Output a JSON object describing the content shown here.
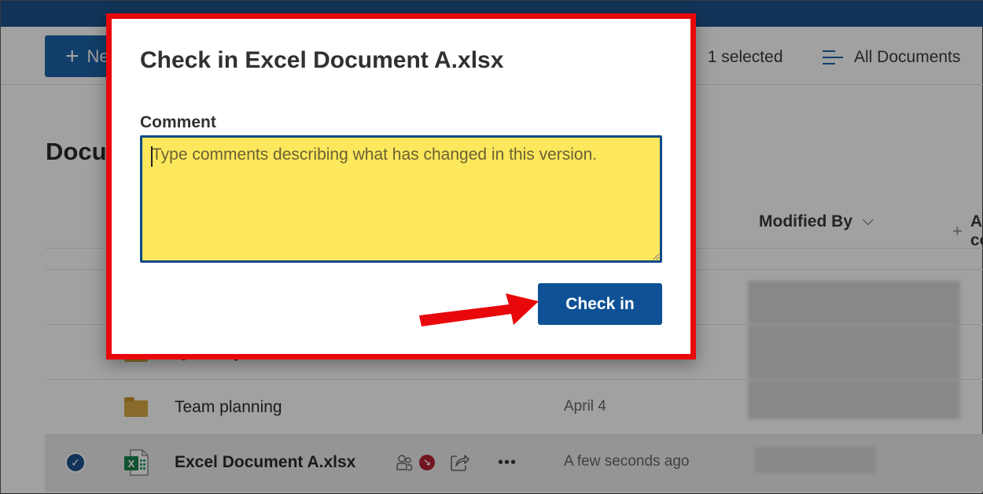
{
  "command_bar": {
    "new_button_label": "New",
    "selected_count_label": "1 selected",
    "view_label": "All Documents"
  },
  "library": {
    "title": "Documents"
  },
  "columns": {
    "modified_by": "Modified By",
    "add_column": "Add column"
  },
  "rows": [
    {
      "name": "Quarterly reviews",
      "type": "folder",
      "modified": "",
      "selected": false
    },
    {
      "name": "Team planning",
      "type": "folder",
      "modified": "April 4",
      "selected": false
    },
    {
      "name": "Excel Document A.xlsx",
      "type": "excel",
      "modified": "A few seconds ago",
      "selected": true,
      "checked_out": true
    }
  ],
  "dialog": {
    "title": "Check in Excel Document A.xlsx",
    "comment_label": "Comment",
    "comment_value": "",
    "comment_placeholder": "Type comments describing what has changed in this version.",
    "checkin_button_label": "Check in"
  },
  "colors": {
    "accent": "#0f5196",
    "highlight_border": "#e8070b",
    "comment_fill": "#fde75c",
    "checked_out_badge": "#b3172a"
  }
}
